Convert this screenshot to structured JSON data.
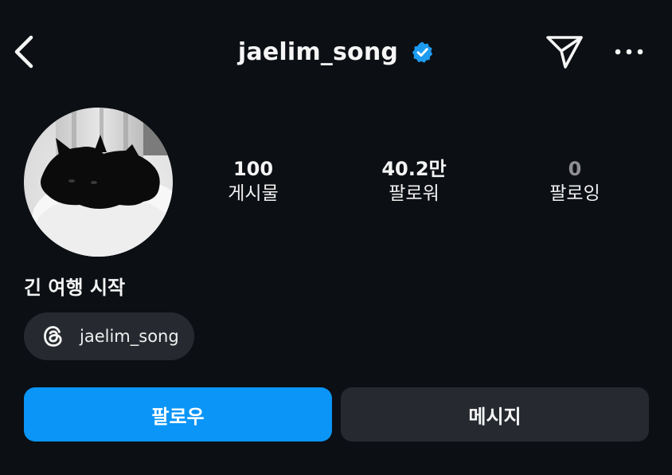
{
  "header": {
    "username": "jaelim_song",
    "back_icon": "chevron-left-icon",
    "verified_icon": "verified-badge-icon",
    "send_icon": "paper-plane-icon",
    "more_icon": "more-horizontal-icon"
  },
  "profile": {
    "avatar": "black-cat-photo",
    "stats": {
      "posts": {
        "value": "100",
        "label": "게시물"
      },
      "followers": {
        "value": "40.2만",
        "label": "팔로워"
      },
      "following": {
        "value": "0",
        "label": "팔로잉"
      }
    },
    "bio": "긴 여행 시작",
    "threads": {
      "icon": "threads-icon",
      "handle": "jaelim_song"
    }
  },
  "actions": {
    "follow_label": "팔로우",
    "message_label": "메시지"
  },
  "colors": {
    "background": "#0c0f14",
    "accent": "#0a95f7",
    "secondary_button": "#262a30",
    "verified": "#1d9bf0"
  }
}
